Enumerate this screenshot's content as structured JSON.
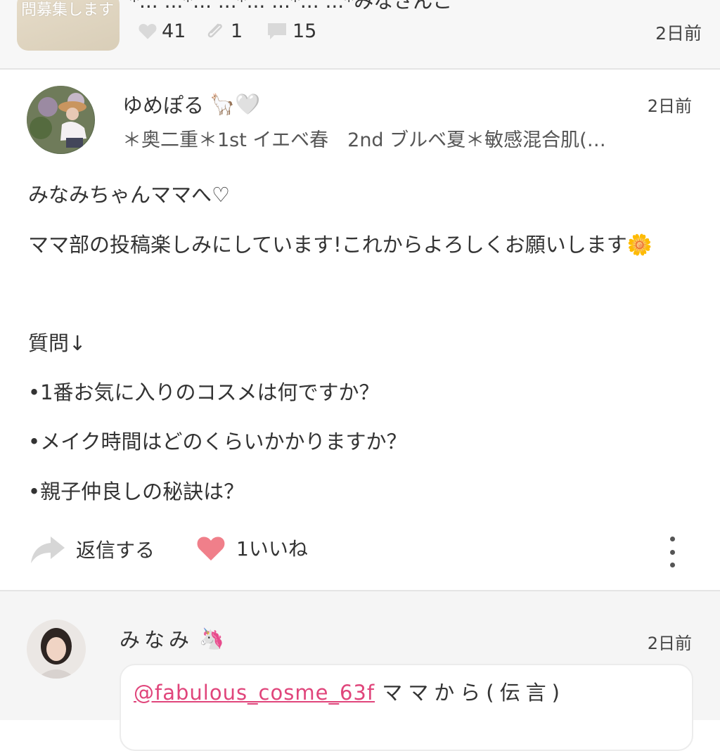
{
  "colors": {
    "accent_pink": "#e0457b",
    "heart_pink": "#f07f8a",
    "background_grey": "#f5f5f5",
    "text": "#333333"
  },
  "top_post": {
    "thumbnail_text": "問募集します",
    "snippet": "*... ...*... ...*... ...*... ...*みなさんこ",
    "likes": "41",
    "clips": "1",
    "comments": "15",
    "time": "2日前"
  },
  "comment1": {
    "username": "ゆめぽる",
    "username_emojis": "🦙🤍",
    "bio": "＊奥二重＊1st イエベ春　2nd ブルベ夏＊敏感混合肌(…",
    "time": "2日前",
    "lines": [
      "みなみちゃんママへ♡",
      "ママ部の投稿楽しみにしています!これからよろしくお願いします🌼",
      "質問↓",
      "•1番お気に入りのコスメは何ですか？",
      "•メイク時間はどのくらいかかりますか？",
      "•親子仲良しの秘訣は？"
    ],
    "reply_label": "返信する",
    "like_label": "1いいね"
  },
  "comment2": {
    "username": "みなみ",
    "username_emoji": "🦄",
    "time": "2日前",
    "mention": "@fabulous_cosme_63f",
    "message": "ママから(伝言)"
  }
}
